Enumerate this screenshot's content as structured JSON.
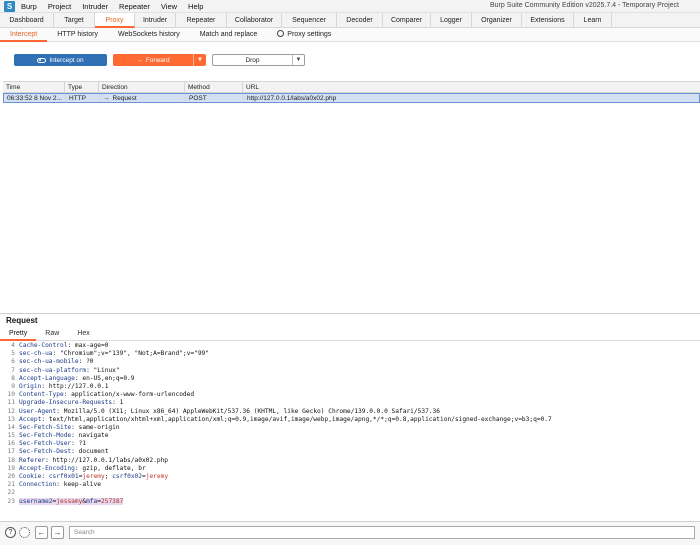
{
  "menubar": {
    "logo": "S",
    "items": [
      "Burp",
      "Project",
      "Intruder",
      "Repeater",
      "View",
      "Help"
    ],
    "window_title": "Burp Suite Community Edition v2025.7.4 - Temporary Project"
  },
  "tool_tabs": [
    "Dashboard",
    "Target",
    "Proxy",
    "Intruder",
    "Repeater",
    "Collaborator",
    "Sequencer",
    "Decoder",
    "Comparer",
    "Logger",
    "Organizer",
    "Extensions",
    "Learn"
  ],
  "proxy_tabs": [
    "Intercept",
    "HTTP history",
    "WebSockets history",
    "Match and replace"
  ],
  "proxy_settings_label": "Proxy settings",
  "toolbar": {
    "intercept_label": "Intercept on",
    "forward_label": "Forward",
    "drop_label": "Drop"
  },
  "history": {
    "columns": [
      "Time",
      "Type",
      "Direction",
      "Method",
      "URL"
    ],
    "rows": [
      {
        "time": "06:33:52 8 Nov 2...",
        "type": "HTTP",
        "direction": "Request",
        "method": "POST",
        "url": "http://127.0.0.1/labs/a0x02.php"
      }
    ]
  },
  "request": {
    "title": "Request",
    "tabs": [
      "Pretty",
      "Raw",
      "Hex"
    ],
    "lines": [
      {
        "n": "4",
        "h": "Cache-Control",
        "v": " max-age=0"
      },
      {
        "n": "5",
        "h": "sec-ch-ua",
        "v": " \"Chromium\";v=\"139\", \"Not;A=Brand\";v=\"99\""
      },
      {
        "n": "6",
        "h": "sec-ch-ua-mobile",
        "v": " ?0"
      },
      {
        "n": "7",
        "h": "sec-ch-ua-platform",
        "v": " \"Linux\""
      },
      {
        "n": "8",
        "h": "Accept-Language",
        "v": " en-US,en;q=0.9"
      },
      {
        "n": "9",
        "h": "Origin",
        "v": " http://127.0.0.1"
      },
      {
        "n": "10",
        "h": "Content-Type",
        "v": " application/x-www-form-urlencoded"
      },
      {
        "n": "11",
        "h": "Upgrade-Insecure-Requests",
        "v": " 1"
      },
      {
        "n": "12",
        "h": "User-Agent",
        "v": " Mozilla/5.0 (X11; Linux x86_64) AppleWebKit/537.36 (KHTML, like Gecko) Chrome/139.0.0.0 Safari/537.36"
      },
      {
        "n": "13",
        "h": "Accept",
        "v": " text/html,application/xhtml+xml,application/xml;q=0.9,image/avif,image/webp,image/apng,*/*;q=0.8,application/signed-exchange;v=b3;q=0.7"
      },
      {
        "n": "14",
        "h": "Sec-Fetch-Site",
        "v": " same-origin"
      },
      {
        "n": "15",
        "h": "Sec-Fetch-Mode",
        "v": " navigate"
      },
      {
        "n": "16",
        "h": "Sec-Fetch-User",
        "v": " ?1"
      },
      {
        "n": "17",
        "h": "Sec-Fetch-Dest",
        "v": " document"
      },
      {
        "n": "18",
        "h": "Referer",
        "v": " http://127.0.0.1/labs/a0x02.php"
      },
      {
        "n": "19",
        "h": "Accept-Encoding",
        "v": " gzip, deflate, br"
      },
      {
        "n": "20",
        "h": "Cookie",
        "v": " ",
        "cookies": [
          {
            "k": "csrf0x01",
            "v": "jeremy"
          },
          {
            "k": "csrf0x02",
            "v": "jeremy"
          }
        ]
      },
      {
        "n": "21",
        "h": "Connection",
        "v": " keep-alive"
      },
      {
        "n": "22",
        "h": "",
        "v": ""
      },
      {
        "n": "23",
        "h": "",
        "v": "",
        "params": [
          {
            "k": "username2",
            "v": "jessamy"
          },
          {
            "k": "mfa",
            "v": "257387"
          }
        ]
      }
    ]
  },
  "bottombar": {
    "search_placeholder": "Search",
    "help_icon": "?",
    "back_glyph": "←",
    "forward_glyph": "→"
  },
  "colors": {
    "accent": "#ff6633",
    "intercept_button": "#3170b5",
    "header_name": "#1d3a8a",
    "cookie_value": "#c0392b",
    "selected_row": "#d3e0f3"
  }
}
